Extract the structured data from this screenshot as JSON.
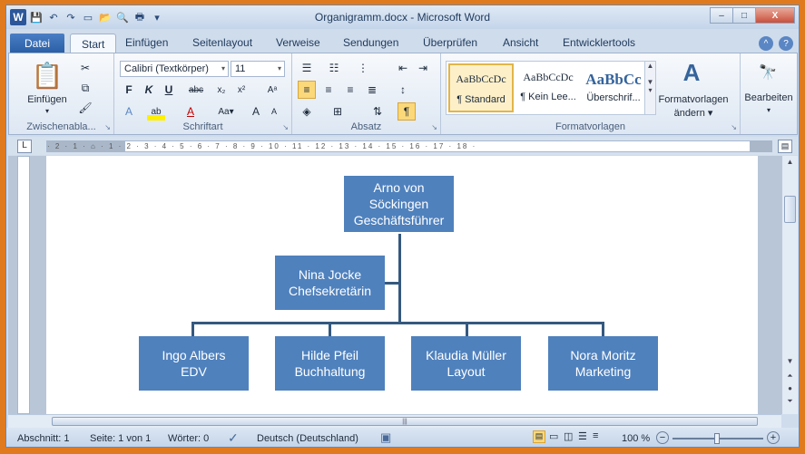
{
  "window": {
    "title": "Organigramm.docx - Microsoft Word",
    "controls": {
      "minimize": "–",
      "maximize": "□",
      "close": "X"
    }
  },
  "qat": {
    "logo": "W",
    "icons": [
      "save-icon",
      "undo-icon",
      "redo-icon",
      "new-document-icon",
      "open-icon",
      "print-preview-icon",
      "print-icon",
      "customize-icon"
    ]
  },
  "tabs": {
    "file": "Datei",
    "items": [
      "Start",
      "Einfügen",
      "Seitenlayout",
      "Verweise",
      "Sendungen",
      "Überprüfen",
      "Ansicht",
      "Entwicklertools"
    ],
    "active": "Start"
  },
  "ribbon": {
    "clipboard": {
      "label": "Zwischenabla...",
      "paste": "Einfügen"
    },
    "font": {
      "label": "Schriftart",
      "font_name": "Calibri (Textkörper)",
      "font_size": "11"
    },
    "paragraph": {
      "label": "Absatz"
    },
    "styles": {
      "label": "Formatvorlagen",
      "items": [
        {
          "preview": "AaBbCcDc",
          "name": "¶ Standard"
        },
        {
          "preview": "AaBbCcDc",
          "name": "¶ Kein Lee..."
        },
        {
          "preview": "AaBbCc",
          "name": "Überschrif..."
        }
      ],
      "change_styles_line1": "Formatvorlagen",
      "change_styles_line2": "ändern ▾"
    },
    "editing": {
      "label": "Bearbeiten"
    }
  },
  "ruler": {
    "marks": "· 2 · 1 · ⌂ · 1 · 2 · 3 · 4 · 5 · 6 · 7 · 8 · 9 · 10 · 11 · 12 · 13 · 14 · 15 · 16 · 17 · 18 ·",
    "tab_selector": "L"
  },
  "orgchart": {
    "root": {
      "line1": "Arno von",
      "line2": "Söckingen",
      "line3": "Geschäftsführer"
    },
    "assistant": {
      "line1": "Nina Jocke",
      "line2": "Chefsekretärin"
    },
    "staff": [
      {
        "line1": "Ingo Albers",
        "line2": "EDV"
      },
      {
        "line1": "Hilde Pfeil",
        "line2": "Buchhaltung"
      },
      {
        "line1": "Klaudia Müller",
        "line2": "Layout"
      },
      {
        "line1": "Nora Moritz",
        "line2": "Marketing"
      }
    ],
    "fill_color": "#4f81bd",
    "line_color": "#35597f"
  },
  "status": {
    "section": "Abschnitt: 1",
    "page": "Seite: 1 von 1",
    "words": "Wörter: 0",
    "language": "Deutsch (Deutschland)",
    "zoom": "100 %",
    "zoom_minus": "−",
    "zoom_plus": "+"
  }
}
